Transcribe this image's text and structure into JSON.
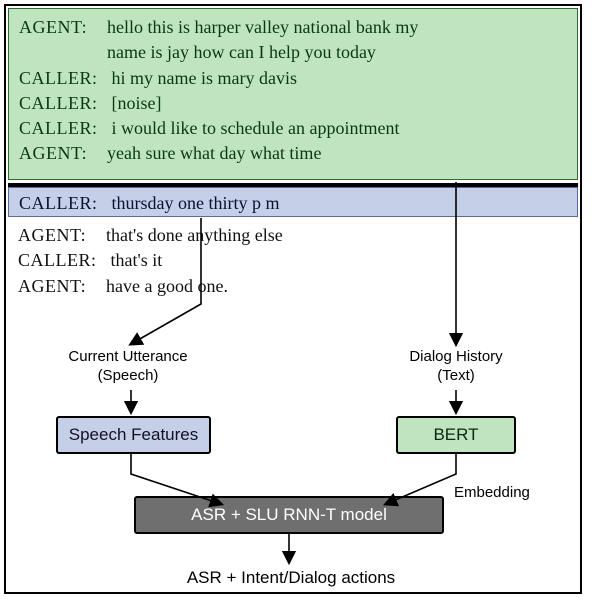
{
  "dialog": {
    "history": [
      {
        "speaker": "AGENT:",
        "text": "hello this is harper valley national bank my",
        "cont": "name is jay how can I help you today"
      },
      {
        "speaker": "CALLER:",
        "text": "hi my name is mary davis"
      },
      {
        "speaker": "CALLER:",
        "text": "[noise]"
      },
      {
        "speaker": "CALLER:",
        "text": "i would like to schedule an appointment"
      },
      {
        "speaker": "AGENT:",
        "text": "yeah sure what day what time"
      }
    ],
    "current": {
      "speaker": "CALLER:",
      "text": "thursday one thirty p m"
    },
    "remaining": [
      {
        "speaker": "AGENT:",
        "text": "that's done anything else"
      },
      {
        "speaker": "CALLER:",
        "text": "that's it"
      },
      {
        "speaker": "AGENT:",
        "text": "have a good one."
      }
    ]
  },
  "flow": {
    "left_label_line1": "Current Utterance",
    "left_label_line2": "(Speech)",
    "right_label_line1": "Dialog History",
    "right_label_line2": "(Text)",
    "speech_box": "Speech Features",
    "bert_box": "BERT",
    "embed_label": "Embedding",
    "rnnt_box": "ASR + SLU RNN-T model",
    "output": "ASR + Intent/Dialog actions"
  }
}
